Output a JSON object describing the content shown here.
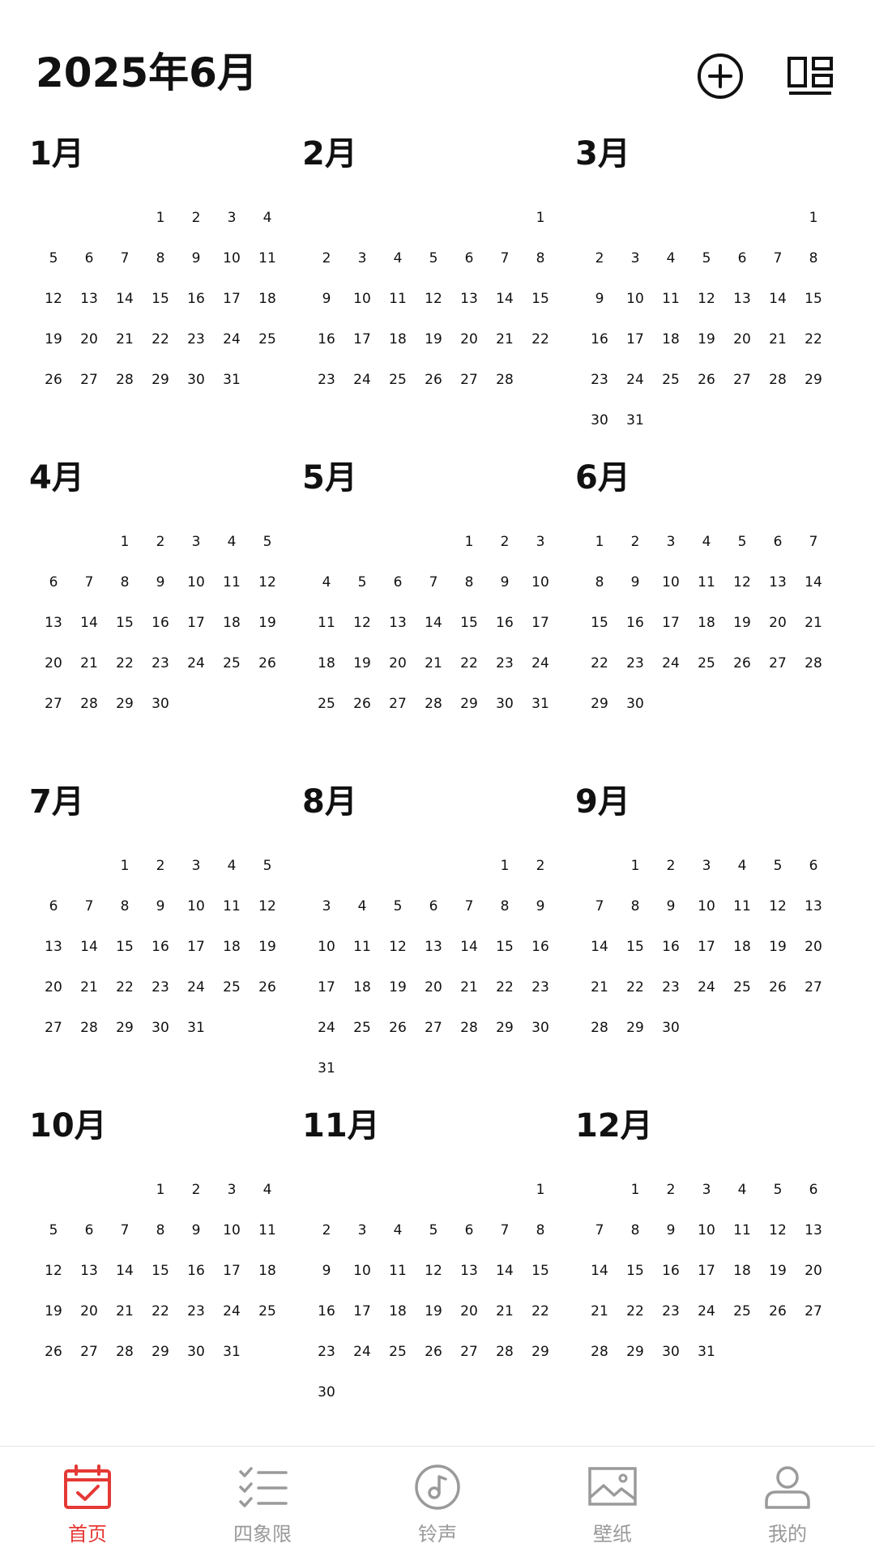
{
  "header": {
    "title": "2025年6月",
    "add_icon": "plus-circle-icon",
    "layout_icon": "layout-grid-icon"
  },
  "colors": {
    "accent": "#e53935",
    "text": "#111111",
    "inactive": "#9a9a9a"
  },
  "months": [
    {
      "label": "1月",
      "offset": 3,
      "days": 31
    },
    {
      "label": "2月",
      "offset": 6,
      "days": 28
    },
    {
      "label": "3月",
      "offset": 6,
      "days": 31
    },
    {
      "label": "4月",
      "offset": 2,
      "days": 30
    },
    {
      "label": "5月",
      "offset": 4,
      "days": 31
    },
    {
      "label": "6月",
      "offset": 0,
      "days": 30
    },
    {
      "label": "7月",
      "offset": 2,
      "days": 31
    },
    {
      "label": "8月",
      "offset": 5,
      "days": 31
    },
    {
      "label": "9月",
      "offset": 1,
      "days": 30
    },
    {
      "label": "10月",
      "offset": 3,
      "days": 31
    },
    {
      "label": "11月",
      "offset": 6,
      "days": 30
    },
    {
      "label": "12月",
      "offset": 1,
      "days": 31
    }
  ],
  "tabs": [
    {
      "label": "首页",
      "icon": "calendar-check-icon",
      "active": true
    },
    {
      "label": "四象限",
      "icon": "checklist-icon",
      "active": false
    },
    {
      "label": "铃声",
      "icon": "music-note-icon",
      "active": false
    },
    {
      "label": "壁纸",
      "icon": "image-icon",
      "active": false
    },
    {
      "label": "我的",
      "icon": "user-icon",
      "active": false
    }
  ]
}
